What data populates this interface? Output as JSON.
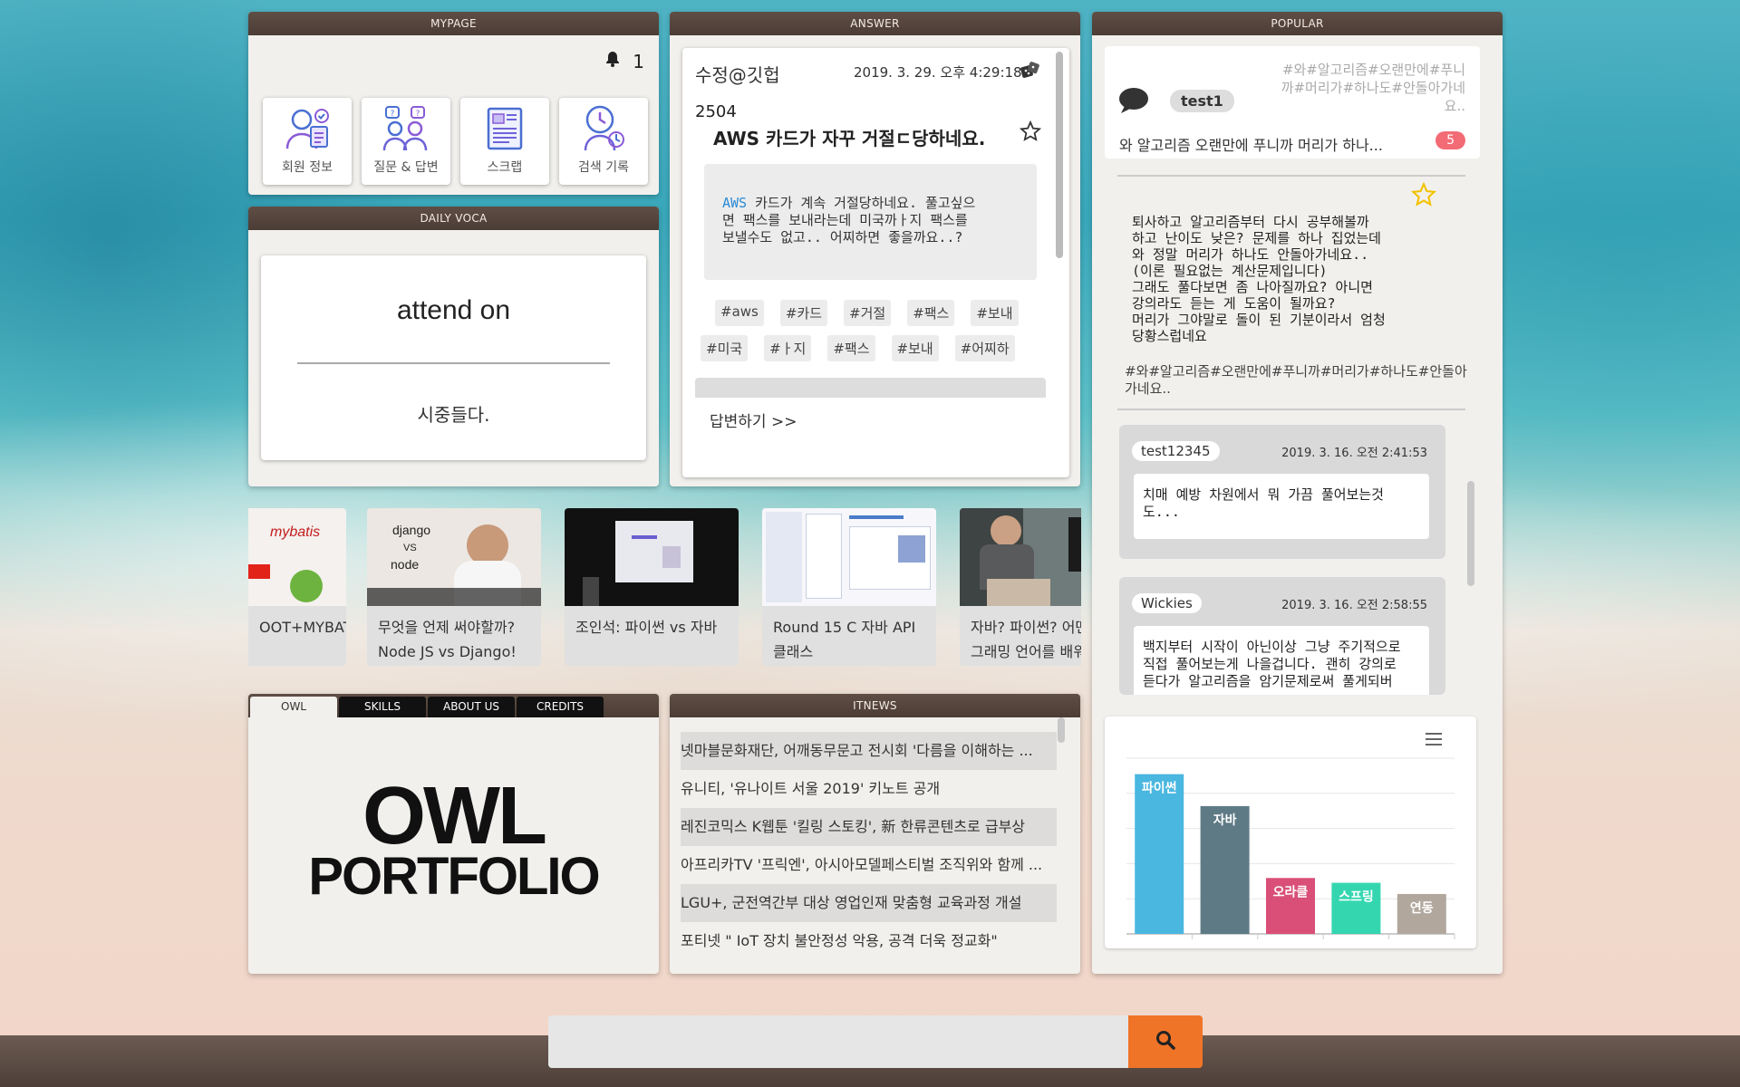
{
  "mypage": {
    "title": "MYPAGE",
    "notification_count": "1",
    "buttons": [
      {
        "label": "회원 정보",
        "icon": "member-info-icon"
      },
      {
        "label": "질문 & 답변",
        "icon": "qna-icon"
      },
      {
        "label": "스크랩",
        "icon": "scrap-icon"
      },
      {
        "label": "검색 기록",
        "icon": "search-history-icon"
      }
    ]
  },
  "voca": {
    "title": "DAILY VOCA",
    "word": "attend on",
    "meaning": "시중들다."
  },
  "answer": {
    "title": "ANSWER",
    "user": "수정@깃헙",
    "date": "2019. 3. 29. 오후 4:29:18",
    "number": "2504",
    "question_title": "AWS 카드가 자꾸 거절ㄷ당하네요.",
    "body_highlight": "AWS",
    "body_lines": [
      " 카드가 계속 거절당하네요. 풀고싶으",
      "면 팩스를 보내라는데 미국까ㅏ지 팩스를",
      " 보낼수도 없고.. 어찌하면 좋을까요..?"
    ],
    "tags": [
      "#aws",
      "#카드",
      "#거절",
      "#팩스",
      "#보내",
      "#미국",
      "#ㅏ지",
      "#팩스",
      "#보내",
      "#어찌하"
    ],
    "reply_label": "답변하기  >>"
  },
  "popular": {
    "title": "POPULAR",
    "user": "test1",
    "tag_text": "#와#알고리즘#오랜만에#푸니까#머리가#하나도#안돌아가네요..",
    "question": "와 알고리즘 오랜만에 푸니까 머리가 하나...",
    "answer_count": "5",
    "body_lines": [
      "퇴사하고 알고리즘부터 다시 공부해볼까",
      "하고 난이도 낮은? 문제를 하나 집었는데",
      "와 정말 머리가 하나도 안돌아가네요..",
      "(이론 필요없는 계산문제입니다)",
      "그래도 풀다보면 좀 나아질까요? 아니면",
      "강의라도 듣는 게 도움이 될까요?",
      "머리가 그야말로 돌이 된 기분이라서 엄청",
      "당황스럽네요"
    ],
    "tags_line": "#와#알고리즘#오랜만에#푸니까#머리가#하나도#안돌아가네요..",
    "comments": [
      {
        "user": "test12345",
        "date": "2019. 3. 16. 오전 2:41:53",
        "body": "치매 예방 차원에서 뭐 가끔 풀어보는것\n도..."
      },
      {
        "user": "Wickies",
        "date": "2019. 3. 16. 오전 2:58:55",
        "body": "백지부터 시작이 아닌이상 그냥 주기적으로\n직접 풀어보는게 나을겁니다. 괜히 강의로\n듣다가 알고리즘을 암기문제로써 풀게되버"
      }
    ]
  },
  "chart_data": {
    "type": "bar",
    "categories": [
      "파이썬",
      "자바",
      "오라클",
      "스프링",
      "연동"
    ],
    "values": [
      100,
      80,
      35,
      32,
      25
    ],
    "colors": [
      "#4ab7e0",
      "#5e7a85",
      "#d94f78",
      "#34d6b0",
      "#b1a79d"
    ],
    "ylim": [
      0,
      110
    ]
  },
  "videos": [
    {
      "caption": "OOT+MYBAT",
      "thumb": "spring-mybatis-thumb"
    },
    {
      "caption": "무엇을 언제 써야할까?\nNode JS vs Django!",
      "thumb": "django-node-thumb"
    },
    {
      "caption": "조인석: 파이썬 vs 자바",
      "thumb": "talk-thumb"
    },
    {
      "caption": "Round 15 C 자바 API\n클래스",
      "thumb": "ide-thumb"
    },
    {
      "caption": "자바? 파이썬? 어떤\n그래밍 언어를 배워",
      "thumb": "person-thumb"
    }
  ],
  "owl": {
    "tabs": [
      "OWL",
      "SKILLS",
      "ABOUT US",
      "CREDITS"
    ],
    "big": "OWL",
    "sub": "PORTFOLIO"
  },
  "itnews": {
    "title": "ITNEWS",
    "items": [
      "넷마블문화재단, 어깨동무문고 전시회 '다름을 이해하는 ...",
      "유니티, '유나이트 서울 2019' 키노트 공개",
      "레진코믹스 K웹툰 '킬링 스토킹', 新 한류콘텐츠로 급부상",
      "아프리카TV '프릭엔', 아시아모델페스티벌 조직위와 함께 ...",
      "LGU+, 군전역간부 대상 영업인재 맞춤형 교육과정 개설",
      "포티넷 \" IoT 장치 불안정성 악용, 공격 더욱 정교화\""
    ]
  },
  "search": {
    "placeholder": ""
  }
}
